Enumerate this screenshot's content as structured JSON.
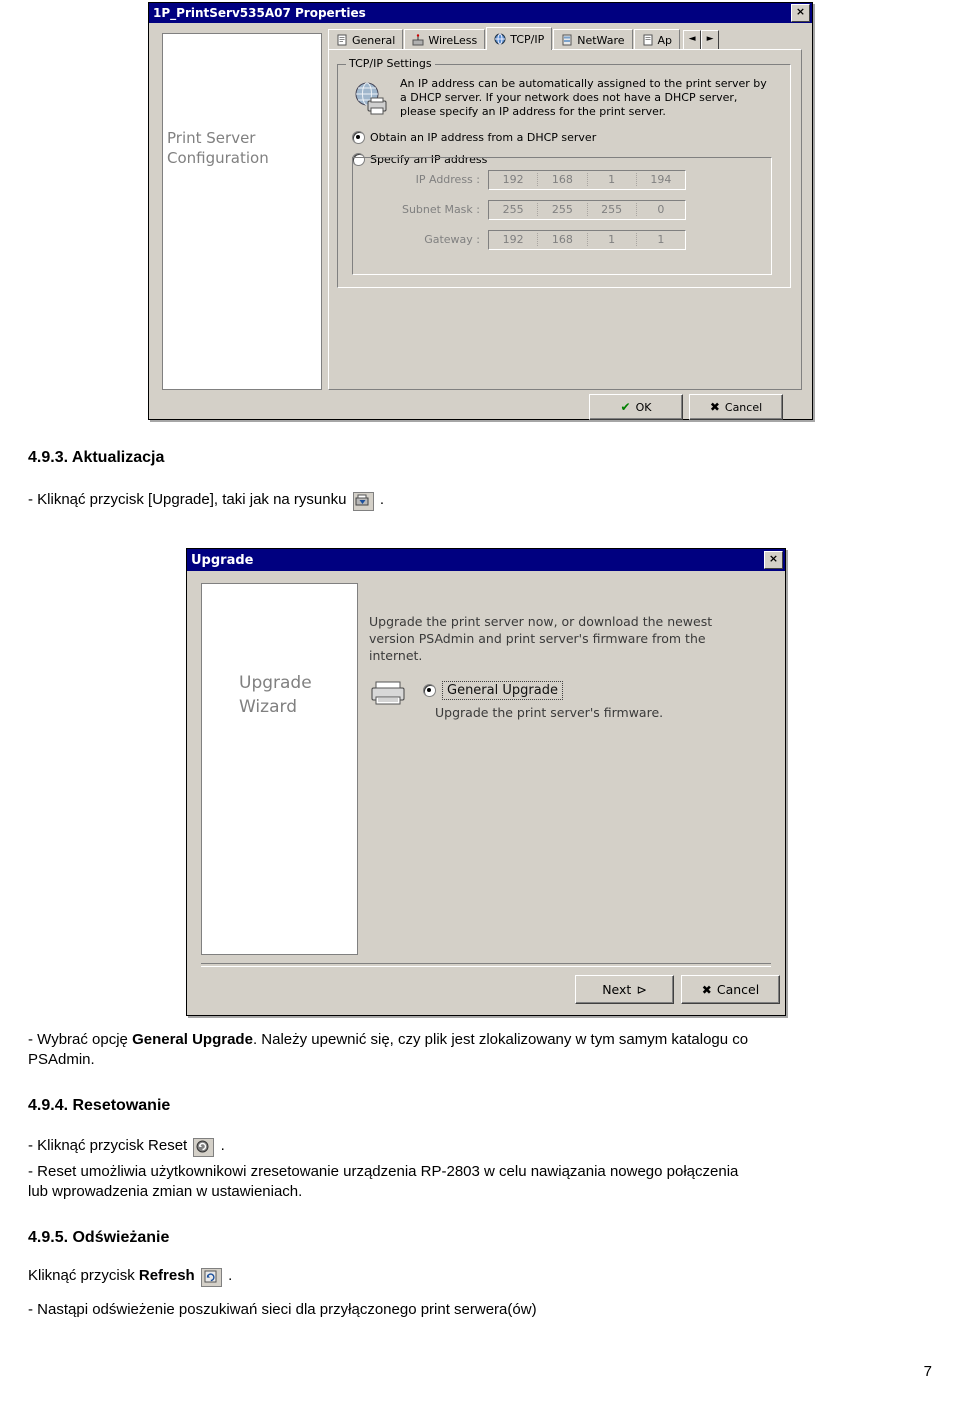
{
  "dialog_props": {
    "title": "1P_PrintServ535A07 Properties",
    "close_label": "×",
    "side_label_line1": "Print Server",
    "side_label_line2": "Configuration",
    "tabs": [
      {
        "label": "General",
        "icon": "document-icon",
        "active": false
      },
      {
        "label": "WireLess",
        "icon": "antenna-icon",
        "active": false
      },
      {
        "label": "TCP/IP",
        "icon": "network-icon",
        "active": true
      },
      {
        "label": "NetWare",
        "icon": "server-icon",
        "active": false
      },
      {
        "label": "Ap",
        "icon": "appletalk-icon",
        "active": false
      }
    ],
    "tab_scroll_left": "◄",
    "tab_scroll_right": "►",
    "group_title": "TCP/IP Settings",
    "description": "An IP address can be automatically assigned to the print server by a DHCP server. If your network does not have a DHCP server, please specify an IP address for the print server.",
    "radio_dhcp": "Obtain an IP address from a DHCP server",
    "radio_static": "Specify an IP address",
    "fields": [
      {
        "label": "IP Address :",
        "segments": [
          "192",
          "168",
          "1",
          "194"
        ]
      },
      {
        "label": "Subnet Mask :",
        "segments": [
          "255",
          "255",
          "255",
          "0"
        ]
      },
      {
        "label": "Gateway :",
        "segments": [
          "192",
          "168",
          "1",
          "1"
        ]
      }
    ],
    "ok_label": "OK",
    "cancel_label": "Cancel"
  },
  "dialog_upgrade": {
    "title": "Upgrade",
    "close_label": "×",
    "side_label_line1": "Upgrade",
    "side_label_line2": "Wizard",
    "description": "Upgrade the print server now, or download the newest version PSAdmin and print server's firmware from the internet.",
    "radio_label": "General Upgrade",
    "sub_label": "Upgrade the print server's firmware.",
    "next_label": "Next",
    "cancel_label": "Cancel"
  },
  "content": {
    "heading_493": "4.9.3. Aktualizacja",
    "line_upgrade_a": "- Kliknąć przycisk [Upgrade], taki jak na rysunku",
    "line_upgrade_b": ".",
    "line_general_pre": "- Wybrać opcję ",
    "line_general_bold": "General Upgrade",
    "line_general_post": ". Należy upewnić się, czy plik jest zlokalizowany w tym samym katalogu co",
    "line_general_post2": "PSAdmin.",
    "heading_494": "4.9.4. Resetowanie",
    "line_reset_pre": "- Kliknąć przycisk Reset",
    "line_reset_post": ".",
    "line_reset_desc1": "- Reset umożliwia użytkownikowi zresetowanie urządzenia RP-2803 w celu nawiązania nowego połączenia",
    "line_reset_desc2": "lub wprowadzenia zmian w ustawieniach.",
    "heading_495": "4.9.5. Odświeżanie",
    "line_refresh_pre": "Kliknąć przycisk ",
    "line_refresh_bold": "Refresh",
    "line_refresh_post": ".",
    "line_refresh_desc": "- Nastąpi odświeżenie poszukiwań sieci dla przyłączonego print serwera(ów)",
    "page_number": "7"
  }
}
